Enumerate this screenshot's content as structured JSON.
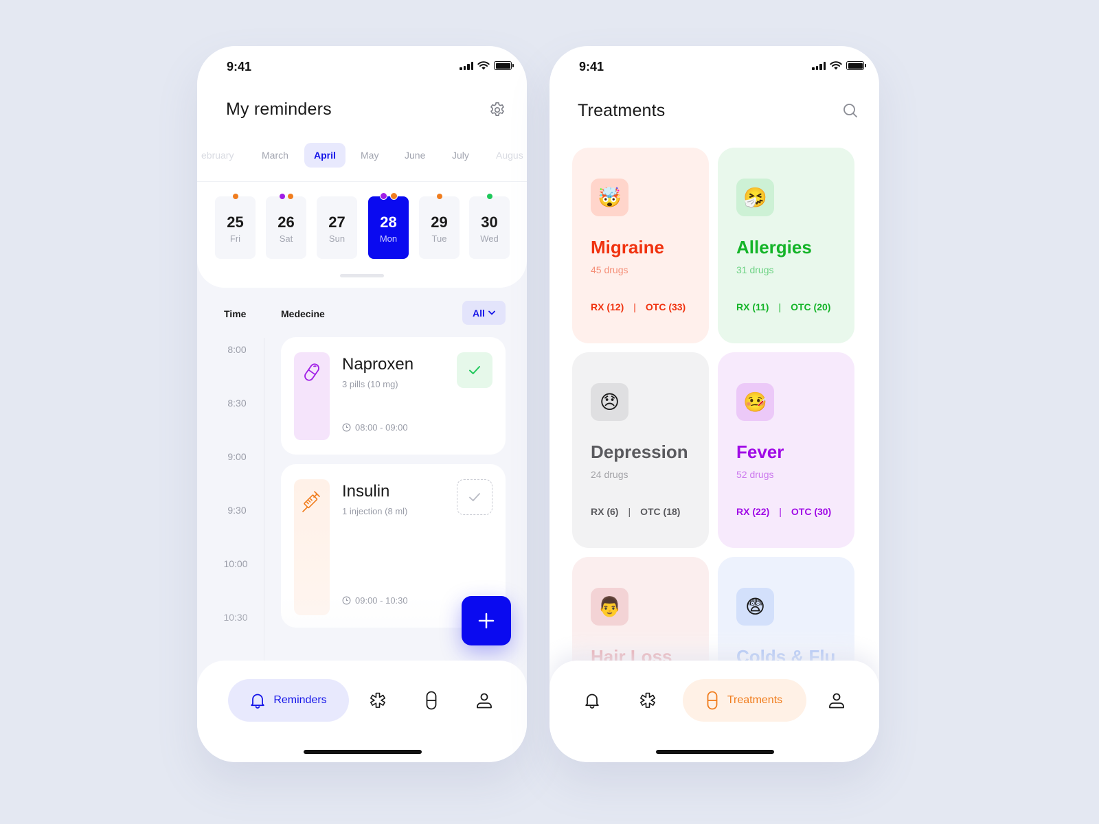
{
  "colors": {
    "accent_blue": "#0a0af0",
    "accent_orange": "#f07d1e",
    "accent_purple": "#a01ee6",
    "accent_green": "#1ec85a"
  },
  "left": {
    "status": {
      "time": "9:41"
    },
    "title": "My reminders",
    "settings_icon": "gear-icon",
    "months": [
      {
        "label": "February",
        "display": "ebruary",
        "state": "faded"
      },
      {
        "label": "March",
        "display": "March",
        "state": "normal"
      },
      {
        "label": "April",
        "display": "April",
        "state": "active"
      },
      {
        "label": "May",
        "display": "May",
        "state": "normal"
      },
      {
        "label": "June",
        "display": "June",
        "state": "normal"
      },
      {
        "label": "July",
        "display": "July",
        "state": "normal"
      },
      {
        "label": "August",
        "display": "Augus",
        "state": "faded"
      }
    ],
    "days": [
      {
        "num": "25",
        "dow": "Fri",
        "dots": [
          "#f07d1e"
        ],
        "active": false
      },
      {
        "num": "26",
        "dow": "Sat",
        "dots": [
          "#a01ee6",
          "#f07d1e"
        ],
        "active": false
      },
      {
        "num": "27",
        "dow": "Sun",
        "dots": [],
        "active": false
      },
      {
        "num": "28",
        "dow": "Mon",
        "dots": [
          "#a01ee6",
          "#f07d1e"
        ],
        "active": true
      },
      {
        "num": "29",
        "dow": "Tue",
        "dots": [
          "#f07d1e"
        ],
        "active": false
      },
      {
        "num": "30",
        "dow": "Wed",
        "dots": [
          "#1ec85a"
        ],
        "active": false
      }
    ],
    "columns": {
      "time": "Time",
      "medicine": "Medecine"
    },
    "filter": {
      "label": "All"
    },
    "time_slots": [
      "8:00",
      "8:30",
      "9:00",
      "9:30",
      "10:00",
      "10:30"
    ],
    "medications": [
      {
        "name": "Naproxen",
        "dose": "3 pills (10 mg)",
        "time_range": "08:00 - 09:00",
        "icon": "pill-icon",
        "status": "done"
      },
      {
        "name": "Insulin",
        "dose": "1 injection (8 ml)",
        "time_range": "09:00 - 10:30",
        "icon": "syringe-icon",
        "status": "pending"
      }
    ],
    "fab_label": "+",
    "tabs": [
      {
        "label": "Reminders",
        "icon": "bell-icon",
        "active": true
      },
      {
        "label": "",
        "icon": "asterisk-icon",
        "active": false
      },
      {
        "label": "",
        "icon": "capsule-icon",
        "active": false
      },
      {
        "label": "",
        "icon": "user-icon",
        "active": false
      }
    ]
  },
  "right": {
    "status": {
      "time": "9:41"
    },
    "title": "Treatments",
    "search_icon": "search-icon",
    "treatments": [
      {
        "name": "Migraine",
        "emoji": "🤯",
        "count": "45 drugs",
        "rx": "RX (12)",
        "otc": "OTC (33)",
        "bg": "#fff0ec",
        "icon_bg": "#ffd5cb",
        "color": "#f0320f",
        "count_color": "#f58f78"
      },
      {
        "name": "Allergies",
        "emoji": "🤧",
        "count": "31 drugs",
        "rx": "RX (11)",
        "otc": "OTC (20)",
        "bg": "#e9f8ec",
        "icon_bg": "#cdf1d5",
        "color": "#14b428",
        "count_color": "#6cd283"
      },
      {
        "name": "Depression",
        "emoji": "😞",
        "count": "24 drugs",
        "rx": "RX (6)",
        "otc": "OTC (18)",
        "bg": "#f2f2f3",
        "icon_bg": "#dfdfe1",
        "color": "#5a5a5e",
        "count_color": "#a4a4a8"
      },
      {
        "name": "Fever",
        "emoji": "🤒",
        "count": "52 drugs",
        "rx": "RX (22)",
        "otc": "OTC (30)",
        "bg": "#f7eafc",
        "icon_bg": "#ecc9f8",
        "color": "#a00ae6",
        "count_color": "#cc7aee"
      },
      {
        "name": "Hair Loss",
        "emoji": "👨",
        "count": "",
        "rx": "",
        "otc": "",
        "bg": "#fbeeee",
        "icon_bg": "#f3d3d5",
        "color": "#e28a90",
        "count_color": "#e8a6a9"
      },
      {
        "name": "Colds & Flu",
        "emoji": "😨",
        "count": "",
        "rx": "",
        "otc": "",
        "bg": "#edf2fd",
        "icon_bg": "#d3e0fb",
        "color": "#8fb0f3",
        "count_color": "#a7c1f5"
      }
    ],
    "tabs": [
      {
        "label": "",
        "icon": "bell-icon",
        "active": false
      },
      {
        "label": "",
        "icon": "asterisk-icon",
        "active": false
      },
      {
        "label": "Treatments",
        "icon": "capsule-icon",
        "active": true
      },
      {
        "label": "",
        "icon": "user-icon",
        "active": false
      }
    ]
  }
}
